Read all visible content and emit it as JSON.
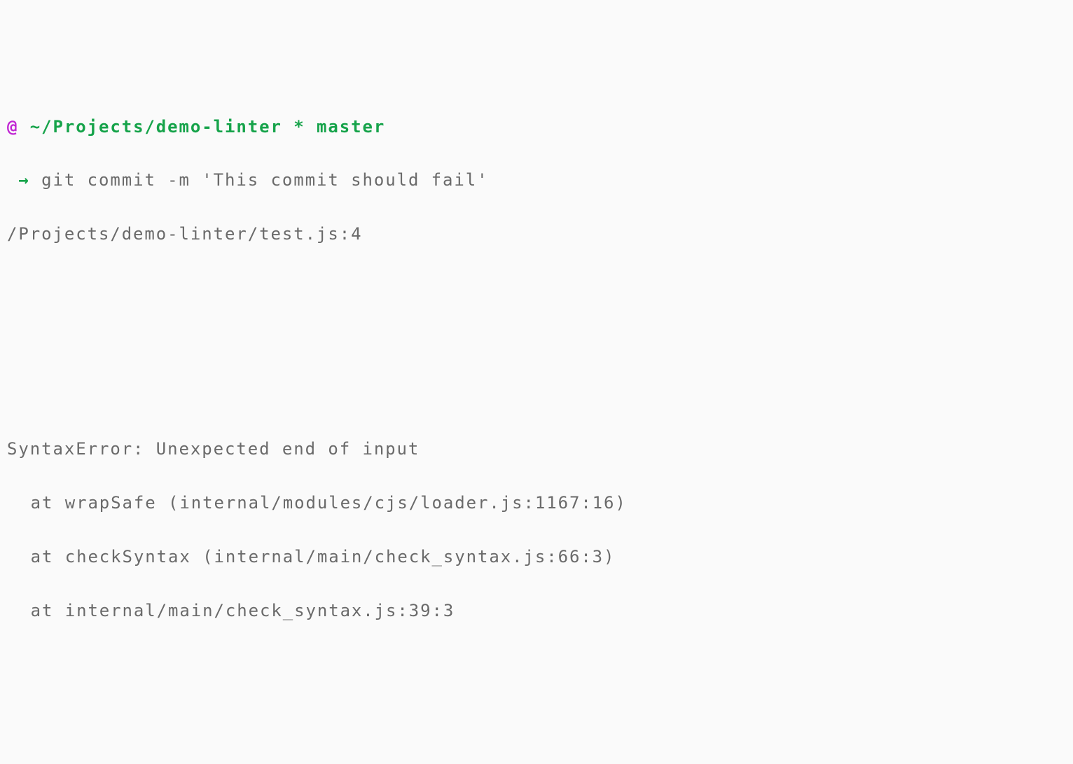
{
  "prompt": {
    "at": "@",
    "space1": " ",
    "path": "~/Projects/demo-linter",
    "space2": " ",
    "asterisk": "*",
    "space3": " ",
    "branch": "master"
  },
  "command_line": {
    "prefix": " ",
    "arrow": "→",
    "space": " ",
    "command": "git commit -m 'This commit should fail'"
  },
  "output": {
    "file_location": "/Projects/demo-linter/test.js:4",
    "error_header": "SyntaxError: Unexpected end of input",
    "stack": [
      "at wrapSafe (internal/modules/cjs/loader.js:1167:16)",
      "at checkSyntax (internal/main/check_syntax.js:66:3)",
      "at internal/main/check_syntax.js:39:3"
    ]
  }
}
